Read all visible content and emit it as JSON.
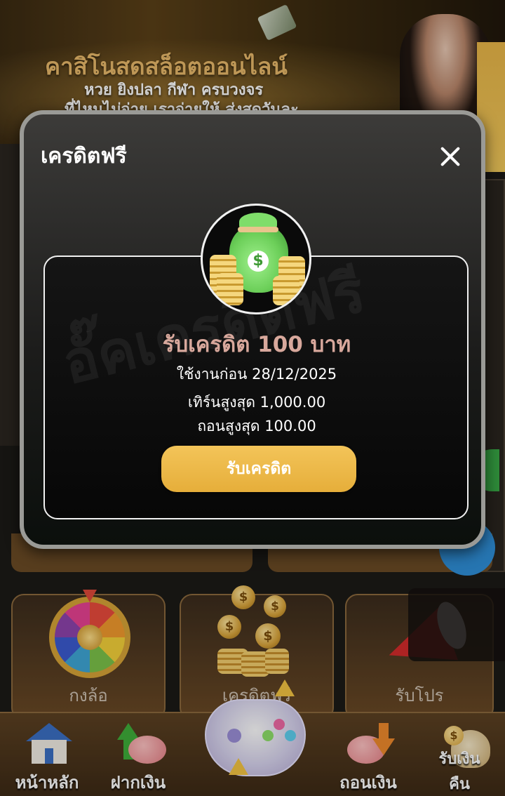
{
  "banner": {
    "title": "คาสิโนสดสล็อตออนไลน์",
    "subtitle_line1": "หวย ยิงปลา กีฬา ครบวงจร",
    "subtitle_line2": "ที่ไหนไม่จ่าย เราจ่ายให้ ส่งสดวันละ"
  },
  "tiles": [
    {
      "label": "กงล้อ",
      "icon": "prize-wheel-icon"
    },
    {
      "label": "เครดิตฟรี",
      "icon": "coins-icon"
    },
    {
      "label": "รับโปร",
      "icon": "megaphone-icon"
    }
  ],
  "bottom_nav": {
    "items": [
      {
        "label": "หน้าหลัก",
        "icon": "home-icon"
      },
      {
        "label": "ฝากเงิน",
        "icon": "deposit-icon"
      },
      {
        "label": "",
        "icon": "game-controller-icon"
      },
      {
        "label": "ถอนเงิน",
        "icon": "withdraw-icon"
      },
      {
        "label": "รับเงินคืน",
        "icon": "cashback-icon"
      }
    ],
    "cashback_line1": "รับเงิน",
    "cashback_line2": "คืน"
  },
  "modal": {
    "title": "เครดิตฟรี",
    "close_icon": "close-icon",
    "watermark": "อั๊คเครดิตฟรี",
    "reward_icon": "money-bag-icon",
    "reward_heading": "รับเครดิต 100 บาท",
    "expiry": "ใช้งานก่อน 28/12/2025",
    "turnover": "เทิร์นสูงสุด 1,000.00",
    "max_withdraw": "ถอนสูงสุด 100.00",
    "claim_button": "รับเครดิต"
  },
  "colors": {
    "accent_gold": "#e6ae3a",
    "heading_pink": "#d8a89c",
    "modal_border": "#9a9a96"
  }
}
